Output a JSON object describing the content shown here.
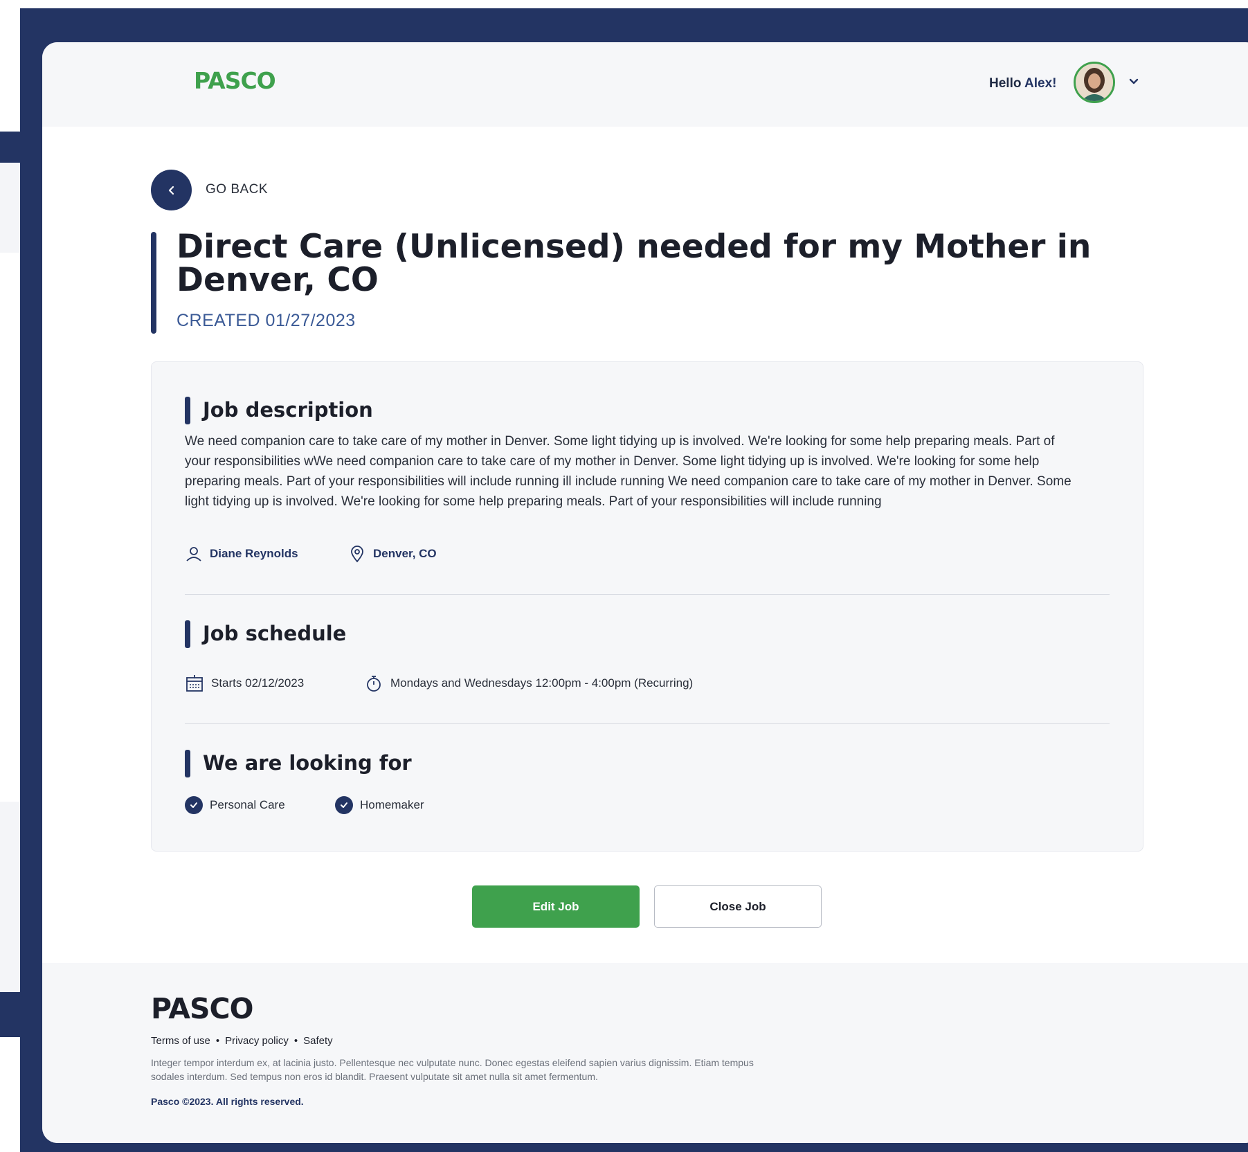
{
  "header": {
    "logo": "PASCO",
    "greeting_prefix": "Hello",
    "greeting_name": "Alex!"
  },
  "nav": {
    "back_label": "GO BACK"
  },
  "job": {
    "title": "Direct Care (Unlicensed) needed for my Mother in Denver, CO",
    "created": "CREATED 01/27/2023"
  },
  "description": {
    "heading": "Job description",
    "text": "We need companion care to take care of my mother in Denver. Some light tidying up is involved.  We're looking for some help preparing meals. Part of your responsibilities wWe need companion care to take care of my mother in Denver. Some light tidying up is involved.  We're looking for some help preparing meals. Part of your responsibilities will include running ill include running We need companion care to take care of my mother in Denver. Some light tidying up is involved.  We're looking for some help preparing meals. Part of your responsibilities will include running",
    "client_name": "Diane Reynolds",
    "location": "Denver, CO"
  },
  "schedule": {
    "heading": "Job schedule",
    "start": "Starts 02/12/2023",
    "recurrence": "Mondays and Wednesdays 12:00pm - 4:00pm (Recurring)"
  },
  "looking_for": {
    "heading": "We are looking for",
    "items": [
      "Personal Care",
      "Homemaker"
    ]
  },
  "actions": {
    "edit_label": "Edit Job",
    "close_label": "Close Job"
  },
  "footer": {
    "logo": "PASCO",
    "links": [
      "Terms of use",
      "Privacy policy",
      "Safety"
    ],
    "separator": "•",
    "body": "Integer tempor interdum ex, at lacinia justo. Pellentesque nec vulputate nunc. Donec egestas eleifend sapien varius dignissim. Etiam tempus sodales interdum. Sed tempus non eros id blandit. Praesent vulputate sit amet nulla sit amet fermentum.",
    "copyright": "Pasco ©2023.  All rights reserved."
  },
  "colors": {
    "navy": "#233463",
    "green": "#3fa14d",
    "panel_bg": "#f6f7f9"
  }
}
